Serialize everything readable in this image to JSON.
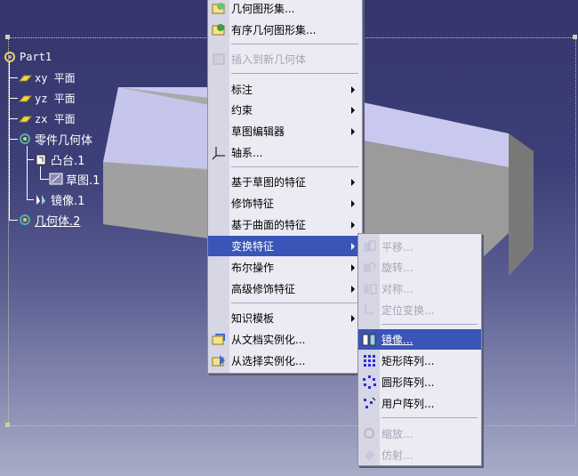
{
  "tree": {
    "root": "Part1",
    "planes": [
      "xy 平面",
      "yz 平面",
      "zx 平面"
    ],
    "body": "零件几何体",
    "pad": "凸台.1",
    "sketch": "草图.1",
    "mirror": "镜像.1",
    "geoset": "几何体.2"
  },
  "main_menu": {
    "items": [
      {
        "label": "几何图形集...",
        "icon": "geometrical-set-icon"
      },
      {
        "label": "有序几何图形集...",
        "icon": "ordered-geometrical-set-icon"
      },
      {
        "label": "插入到新几何体",
        "icon": "insert-in-new-body-icon",
        "disabled": true
      },
      {
        "label": "标注",
        "submenu": true
      },
      {
        "label": "约束",
        "submenu": true
      },
      {
        "label": "草图编辑器",
        "submenu": true
      },
      {
        "label": "轴系...",
        "icon": "axis-system-icon"
      },
      {
        "label": "基于草图的特征",
        "submenu": true
      },
      {
        "label": "修饰特征",
        "submenu": true
      },
      {
        "label": "基于曲面的特征",
        "submenu": true
      },
      {
        "label": "变换特征",
        "submenu": true,
        "highlighted": true
      },
      {
        "label": "布尔操作",
        "submenu": true
      },
      {
        "label": "高级修饰特征",
        "submenu": true
      },
      {
        "label": "知识模板",
        "submenu": true
      },
      {
        "label": "从文档实例化...",
        "icon": "instantiate-from-document-icon"
      },
      {
        "label": "从选择实例化...",
        "icon": "instantiate-from-selection-icon"
      }
    ]
  },
  "sub_menu": {
    "items": [
      {
        "label": "平移...",
        "disabled": true
      },
      {
        "label": "旋转...",
        "disabled": true
      },
      {
        "label": "对称...",
        "disabled": true
      },
      {
        "label": "定位变换...",
        "disabled": true
      },
      {
        "label": "镜像...",
        "highlighted": true
      },
      {
        "label": "矩形阵列..."
      },
      {
        "label": "圆形阵列..."
      },
      {
        "label": "用户阵列..."
      },
      {
        "label": "缩放...",
        "disabled": true
      },
      {
        "label": "仿射...",
        "disabled": true
      }
    ]
  }
}
